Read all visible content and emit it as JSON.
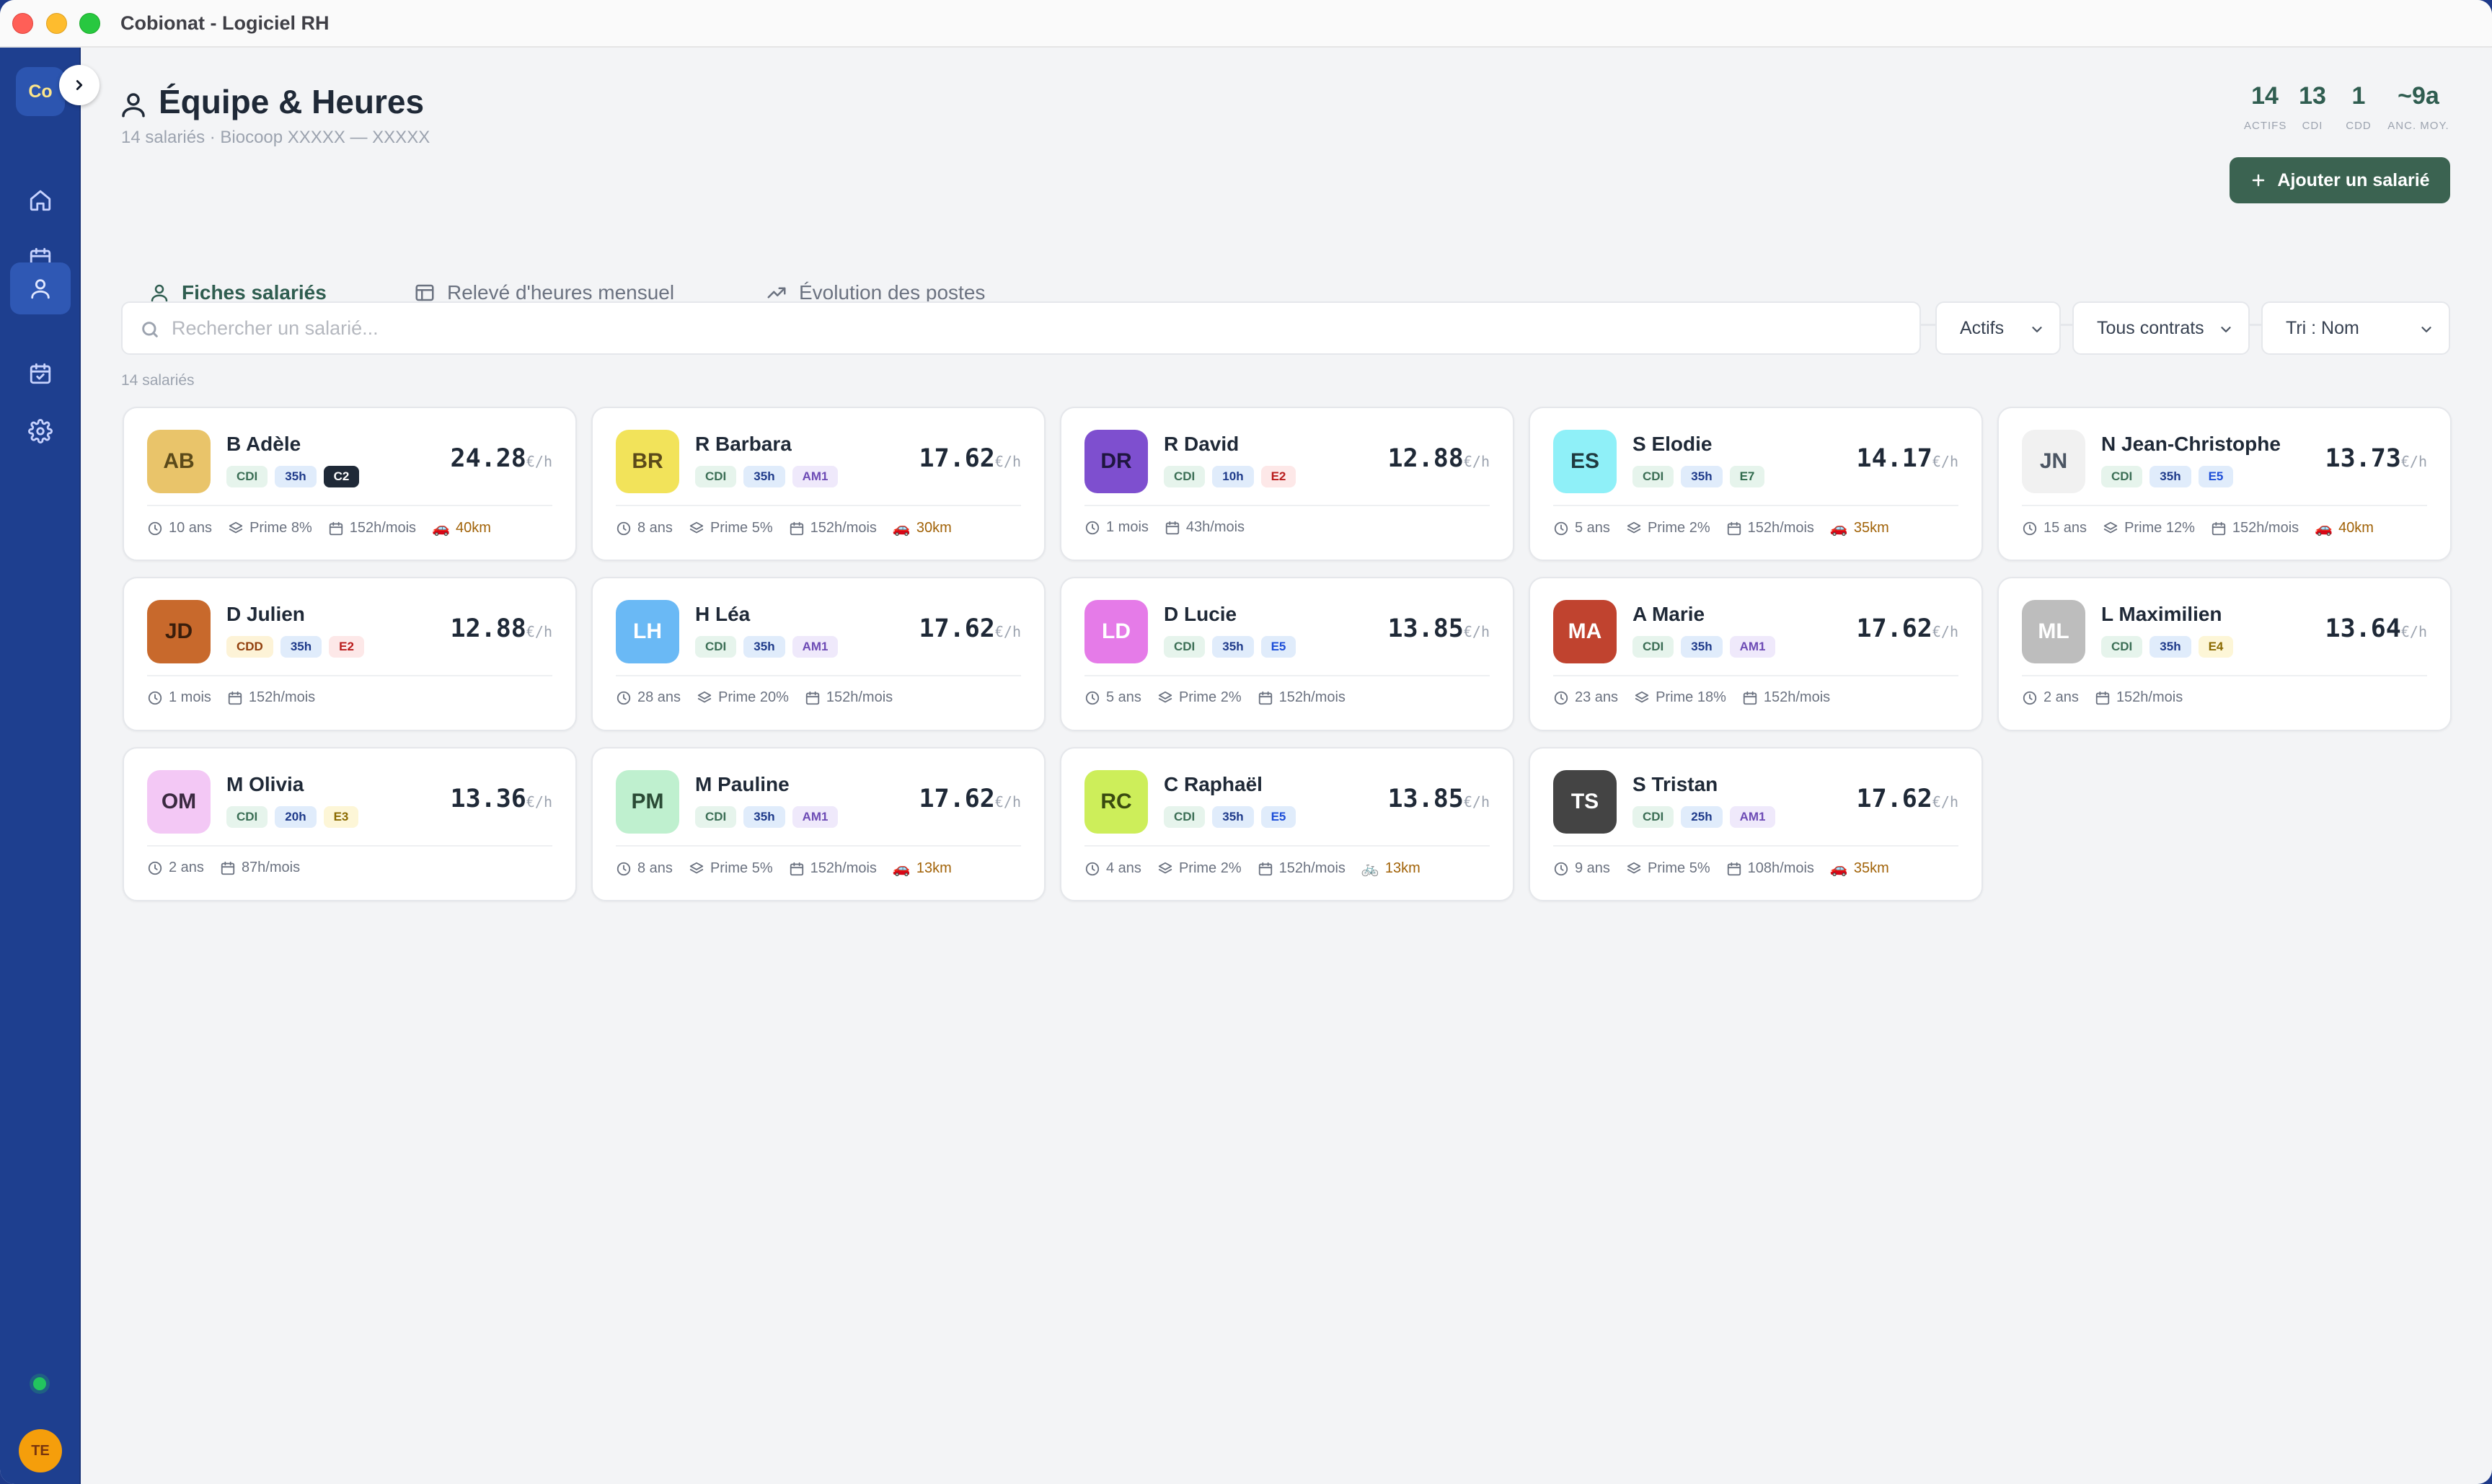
{
  "window": {
    "title": "Cobionat - Logiciel RH"
  },
  "sidebar": {
    "logo": "Co",
    "user_initials": "TE"
  },
  "header": {
    "title": "Équipe & Heures",
    "subtitle": "14 salariés · Biocoop XXXXX — XXXXX",
    "stats": [
      {
        "value": "14",
        "label": "ACTIFS"
      },
      {
        "value": "13",
        "label": "CDI"
      },
      {
        "value": "1",
        "label": "CDD"
      },
      {
        "value": "~9a",
        "label": "ANC. MOY."
      }
    ],
    "add_button": "Ajouter un salarié"
  },
  "tabs": [
    {
      "label": "Fiches salariés",
      "active": true
    },
    {
      "label": "Relevé d'heures mensuel",
      "active": false
    },
    {
      "label": "Évolution des postes",
      "active": false
    }
  ],
  "filters": {
    "search_placeholder": "Rechercher un salarié...",
    "status": "Actifs",
    "contract": "Tous contrats",
    "sort": "Tri : Nom"
  },
  "count_label": "14 salariés",
  "rate_unit": "€/h",
  "employees": [
    {
      "initials": "AB",
      "name": "B Adèle",
      "contract": "CDI",
      "hours": "35h",
      "level": "C2",
      "level_style": "dark",
      "rate": "24.28",
      "anciennete": "10 ans",
      "prime": "Prime 8%",
      "monthly": "152h/mois",
      "distance": "40km",
      "transport": "car",
      "avatar_bg": "#e9c46a",
      "avatar_fg": "#5b4a1a"
    },
    {
      "initials": "BR",
      "name": "R Barbara",
      "contract": "CDI",
      "hours": "35h",
      "level": "AM1",
      "level_style": "am",
      "rate": "17.62",
      "anciennete": "8 ans",
      "prime": "Prime 5%",
      "monthly": "152h/mois",
      "distance": "30km",
      "transport": "car",
      "avatar_bg": "#f2e35a",
      "avatar_fg": "#5b4a1a"
    },
    {
      "initials": "DR",
      "name": "R David",
      "contract": "CDI",
      "hours": "10h",
      "level": "E2",
      "level_style": "e-red",
      "rate": "12.88",
      "anciennete": "1 mois",
      "prime": "",
      "monthly": "43h/mois",
      "distance": "",
      "transport": "",
      "avatar_bg": "#7e4fcf",
      "avatar_fg": "#1f1640"
    },
    {
      "initials": "ES",
      "name": "S Elodie",
      "contract": "CDI",
      "hours": "35h",
      "level": "E7",
      "level_style": "e-green",
      "rate": "14.17",
      "anciennete": "5 ans",
      "prime": "Prime 2%",
      "monthly": "152h/mois",
      "distance": "35km",
      "transport": "car",
      "avatar_bg": "#8ff0f8",
      "avatar_fg": "#1f3a40"
    },
    {
      "initials": "JN",
      "name": "N Jean-Christophe",
      "contract": "CDI",
      "hours": "35h",
      "level": "E5",
      "level_style": "e-blue",
      "rate": "13.73",
      "anciennete": "15 ans",
      "prime": "Prime 12%",
      "monthly": "152h/mois",
      "distance": "40km",
      "transport": "car",
      "avatar_bg": "#f1f1f1",
      "avatar_fg": "#4b5563"
    },
    {
      "initials": "JD",
      "name": "D Julien",
      "contract": "CDD",
      "hours": "35h",
      "level": "E2",
      "level_style": "e-red",
      "rate": "12.88",
      "anciennete": "1 mois",
      "prime": "",
      "monthly": "152h/mois",
      "distance": "",
      "transport": "",
      "avatar_bg": "#c8692c",
      "avatar_fg": "#3a1e0c"
    },
    {
      "initials": "LH",
      "name": "H Léa",
      "contract": "CDI",
      "hours": "35h",
      "level": "AM1",
      "level_style": "am",
      "rate": "17.62",
      "anciennete": "28 ans",
      "prime": "Prime 20%",
      "monthly": "152h/mois",
      "distance": "",
      "transport": "",
      "avatar_bg": "#6ab9f5",
      "avatar_fg": "#ffffff"
    },
    {
      "initials": "LD",
      "name": "D Lucie",
      "contract": "CDI",
      "hours": "35h",
      "level": "E5",
      "level_style": "e-blue",
      "rate": "13.85",
      "anciennete": "5 ans",
      "prime": "Prime 2%",
      "monthly": "152h/mois",
      "distance": "",
      "transport": "",
      "avatar_bg": "#e57be8",
      "avatar_fg": "#ffffff"
    },
    {
      "initials": "MA",
      "name": "A Marie",
      "contract": "CDI",
      "hours": "35h",
      "level": "AM1",
      "level_style": "am",
      "rate": "17.62",
      "anciennete": "23 ans",
      "prime": "Prime 18%",
      "monthly": "152h/mois",
      "distance": "",
      "transport": "",
      "avatar_bg": "#c0432f",
      "avatar_fg": "#ffffff"
    },
    {
      "initials": "ML",
      "name": "L Maximilien",
      "contract": "CDI",
      "hours": "35h",
      "level": "E4",
      "level_style": "e-yellow",
      "rate": "13.64",
      "anciennete": "2 ans",
      "prime": "",
      "monthly": "152h/mois",
      "distance": "",
      "transport": "",
      "avatar_bg": "#bdbdbd",
      "avatar_fg": "#ffffff"
    },
    {
      "initials": "OM",
      "name": "M Olivia",
      "contract": "CDI",
      "hours": "20h",
      "level": "E3",
      "level_style": "e-yellow",
      "rate": "13.36",
      "anciennete": "2 ans",
      "prime": "",
      "monthly": "87h/mois",
      "distance": "",
      "transport": "",
      "avatar_bg": "#f3c8f5",
      "avatar_fg": "#3a2a40"
    },
    {
      "initials": "PM",
      "name": "M Pauline",
      "contract": "CDI",
      "hours": "35h",
      "level": "AM1",
      "level_style": "am",
      "rate": "17.62",
      "anciennete": "8 ans",
      "prime": "Prime 5%",
      "monthly": "152h/mois",
      "distance": "13km",
      "transport": "car",
      "avatar_bg": "#bff0cf",
      "avatar_fg": "#2a4a35"
    },
    {
      "initials": "RC",
      "name": "C Raphaël",
      "contract": "CDI",
      "hours": "35h",
      "level": "E5",
      "level_style": "e-blue",
      "rate": "13.85",
      "anciennete": "4 ans",
      "prime": "Prime 2%",
      "monthly": "152h/mois",
      "distance": "13km",
      "transport": "bike",
      "avatar_bg": "#cdee5a",
      "avatar_fg": "#3a4a10"
    },
    {
      "initials": "TS",
      "name": "S Tristan",
      "contract": "CDI",
      "hours": "25h",
      "level": "AM1",
      "level_style": "am",
      "rate": "17.62",
      "anciennete": "9 ans",
      "prime": "Prime 5%",
      "monthly": "108h/mois",
      "distance": "35km",
      "transport": "car",
      "avatar_bg": "#444444",
      "avatar_fg": "#ffffff"
    }
  ]
}
